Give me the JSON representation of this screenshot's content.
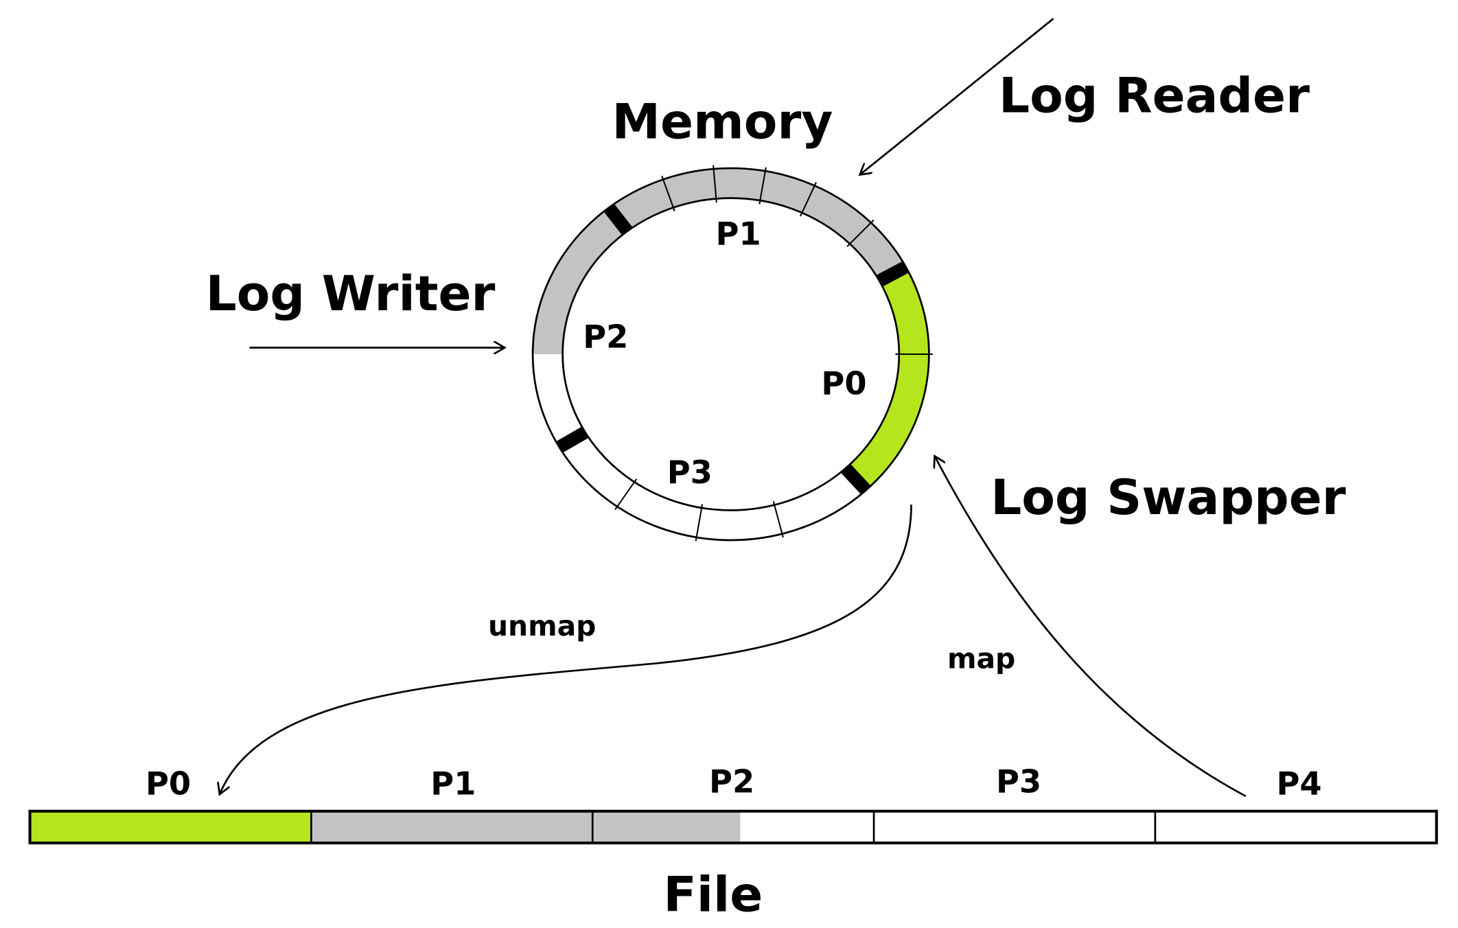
{
  "labels": {
    "memory": "Memory",
    "log_reader": "Log Reader",
    "log_writer": "Log Writer",
    "log_swapper": "Log Swapper",
    "unmap": "unmap",
    "map": "map",
    "file": "File"
  },
  "ring_pages": [
    "P0",
    "P1",
    "P2",
    "P3"
  ],
  "file_pages": [
    "P0",
    "P1",
    "P2",
    "P3",
    "P4"
  ],
  "colors": {
    "mapped_green": "#b5e61d",
    "used_gray": "#c3c3c3",
    "free_white": "#ffffff",
    "outline": "#000000"
  }
}
